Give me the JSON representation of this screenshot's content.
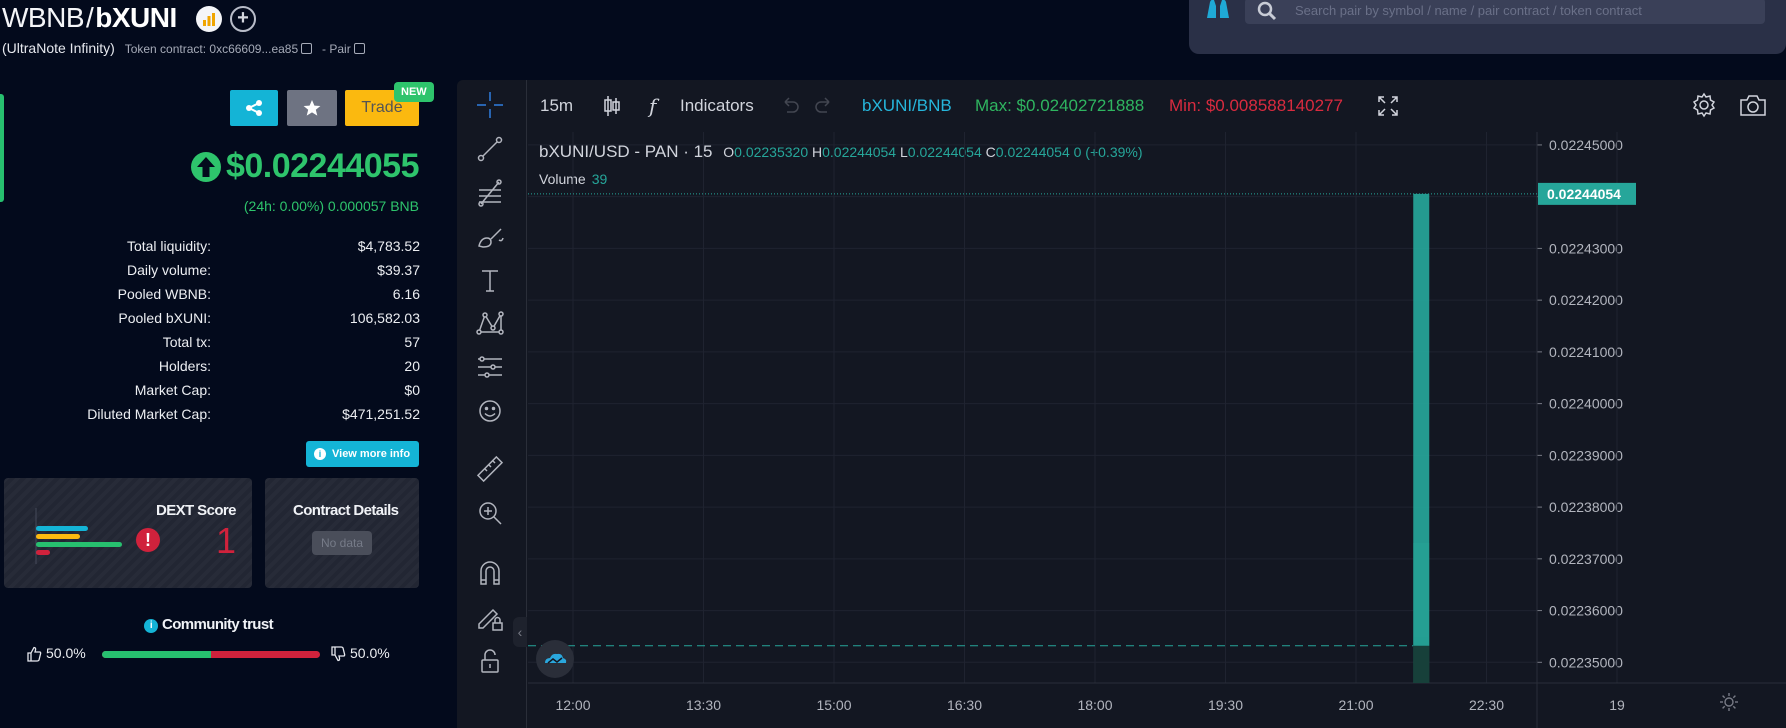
{
  "header": {
    "base": "WBNB",
    "separator": "/",
    "token": "bXUNI",
    "token_name": "(UltraNote Infinity)",
    "contract_label": "Token contract: 0xc66609...ea85",
    "pair_label": "- Pair",
    "search_placeholder": "Search pair by symbol / name / pair contract / token contract"
  },
  "actions": {
    "trade_label": "Trade",
    "new_badge": "NEW"
  },
  "price": {
    "value": "$0.02244055",
    "change": "(24h: 0.00%) 0.000057 BNB",
    "color": "#2ec46c"
  },
  "stats": [
    {
      "label": "Total liquidity:",
      "value": "$4,783.52"
    },
    {
      "label": "Daily volume:",
      "value": "$39.37"
    },
    {
      "label": "Pooled WBNB:",
      "value": "6.16"
    },
    {
      "label": "Pooled bXUNI:",
      "value": "106,582.03"
    },
    {
      "label": "Total tx:",
      "value": "57"
    },
    {
      "label": "Holders:",
      "value": "20"
    },
    {
      "label": "Market Cap:",
      "value": "$0"
    },
    {
      "label": "Diluted Market Cap:",
      "value": "$471,251.52"
    }
  ],
  "view_more_label": "View more info",
  "dext": {
    "title": "DEXT Score",
    "score": "1",
    "warning": "!"
  },
  "contract": {
    "title": "Contract Details",
    "status": "No data"
  },
  "community": {
    "title": "Community trust",
    "up": "50.0%",
    "down": "50.0%",
    "up_fraction": 0.5
  },
  "chart_toolbar": {
    "interval": "15m",
    "fx": "f",
    "indicators": "Indicators",
    "symbol": "bXUNI/BNB",
    "max": "Max: $0.02402721888",
    "min": "Min: $0.008588140277"
  },
  "legend": {
    "title": "bXUNI/USD - PAN · 15",
    "o_key": "O",
    "o": "0.02235320",
    "h_key": "H",
    "h": "0.02244054",
    "l_key": "L",
    "l": "0.02244054",
    "c_key": "C",
    "c": "0.02244054",
    "change": "0 (+0.39%)",
    "volume_label": "Volume",
    "volume": "39"
  },
  "colors": {
    "accent": "#14b4d6",
    "up": "#26a69a",
    "positive": "#2ec46c",
    "negative": "#d0223c",
    "trade": "#fbb90f"
  },
  "icons": [
    "share-icon",
    "star-icon",
    "arrow-up-circle-icon",
    "info-icon",
    "thumbs-up-icon",
    "thumbs-down-icon",
    "search-icon",
    "binoculars-icon",
    "crosshair-icon",
    "trendline-icon",
    "fib-icon",
    "brush-icon",
    "text-icon",
    "pattern-icon",
    "forecast-icon",
    "emoji-icon",
    "ruler-icon",
    "zoom-in-icon",
    "magnet-icon",
    "lock-draw-icon",
    "unlock-icon",
    "gear-icon",
    "camera-icon",
    "fullscreen-icon",
    "candles-icon",
    "undo-icon",
    "redo-icon",
    "sun-icon"
  ],
  "chart_data": {
    "type": "bar",
    "title": "bXUNI/USD - PAN · 15",
    "x_ticks": [
      "12:00",
      "13:30",
      "15:00",
      "16:30",
      "18:00",
      "19:30",
      "21:00",
      "22:30",
      "19"
    ],
    "y_ticks": [
      "0.02245000",
      "0.02244000",
      "0.02243000",
      "0.02242000",
      "0.02241000",
      "0.02240000",
      "0.02239000",
      "0.02238000",
      "0.02237000",
      "0.02236000",
      "0.02235000"
    ],
    "ylim": [
      0.022346,
      0.0224525
    ],
    "last_price_label": "0.02244054",
    "last_price": 0.02244054,
    "candle": {
      "time": "21:45",
      "open": 0.0223532,
      "high": 0.02244054,
      "low": 0.02244054,
      "close": 0.02244054
    },
    "prior_close_line": 0.0223532,
    "grid": true
  }
}
